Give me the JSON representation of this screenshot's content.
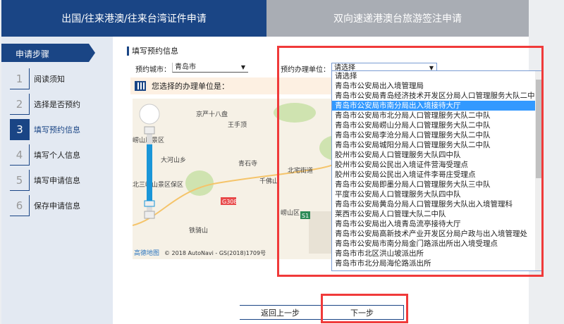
{
  "tabs": [
    {
      "label": "出国/往来港澳/往来台湾证件申请",
      "active": true
    },
    {
      "label": "双向速递港澳台旅游签注申请",
      "active": false
    }
  ],
  "sidebar": {
    "title": "申请步骤",
    "steps": [
      {
        "num": "1",
        "label": "阅读须知"
      },
      {
        "num": "2",
        "label": "选择是否预约"
      },
      {
        "num": "3",
        "label": "填写预约信息",
        "active": true
      },
      {
        "num": "4",
        "label": "填写个人信息"
      },
      {
        "num": "5",
        "label": "填写申请信息"
      },
      {
        "num": "6",
        "label": "保存申请信息"
      }
    ]
  },
  "form": {
    "section_title": "填写预约信息",
    "city_label": "预约城市：",
    "city_value": "青岛市",
    "unit_label": "预约办理单位：",
    "unit_value": "请选择",
    "info_text": "您选择的办理单位是："
  },
  "dropdown": {
    "selected_index": 3,
    "options": [
      "请选择",
      "青岛市公安局出入境管理局",
      "青岛市公安局青岛经济技术开发区分局人口管理服务大队二中队",
      "青岛市公安局市南分局出入境接待大厅",
      "青岛市公安局市北分局人口管理服务大队二中队",
      "青岛市公安局崂山分局人口管理服务大队二中队",
      "青岛市公安局李沧分局人口管理服务大队二中队",
      "青岛市公安局城阳分局人口管理服务大队二中队",
      "胶州市公安局人口管理服务大队四中队",
      "胶州市公安局公民出入境证件营海受理点",
      "胶州市公安局公民出入境证件李哥庄受理点",
      "青岛市公安局即墨分局人口管理服务大队三中队",
      "平度市公安局人口管理服务大队四中队",
      "青岛市公安局黄岛分局人口管理服务大队出入境管理科",
      "莱西市公安局人口管理大队二中队",
      "青岛市公安局出入境青岛流亭接待大厅",
      "青岛市公安局高新技术产业开发区分局户政与出入境管理处",
      "青岛市公安局市南分局金门路派出所出入境受理点",
      "青岛市市北区洪山坡派出所",
      "青岛市市北分局海伦路派出所"
    ]
  },
  "map": {
    "labels": [
      "京严十八盘",
      "王手顶",
      "崂山风景区",
      "大河山乡",
      "青石寺",
      "千佛山",
      "北宅街道",
      "崂山区",
      "铁骑山",
      "北三崂山景区保区",
      "G308",
      "S1"
    ],
    "attribution_logo": "高德地图",
    "attribution": "© 2018 AutoNavi - GS(2018)1709号"
  },
  "buttons": {
    "back": "返回上一步",
    "next": "下一步"
  },
  "colors": {
    "primary": "#1a4585",
    "highlight": "#f03a3a",
    "selected": "#3399ff"
  }
}
